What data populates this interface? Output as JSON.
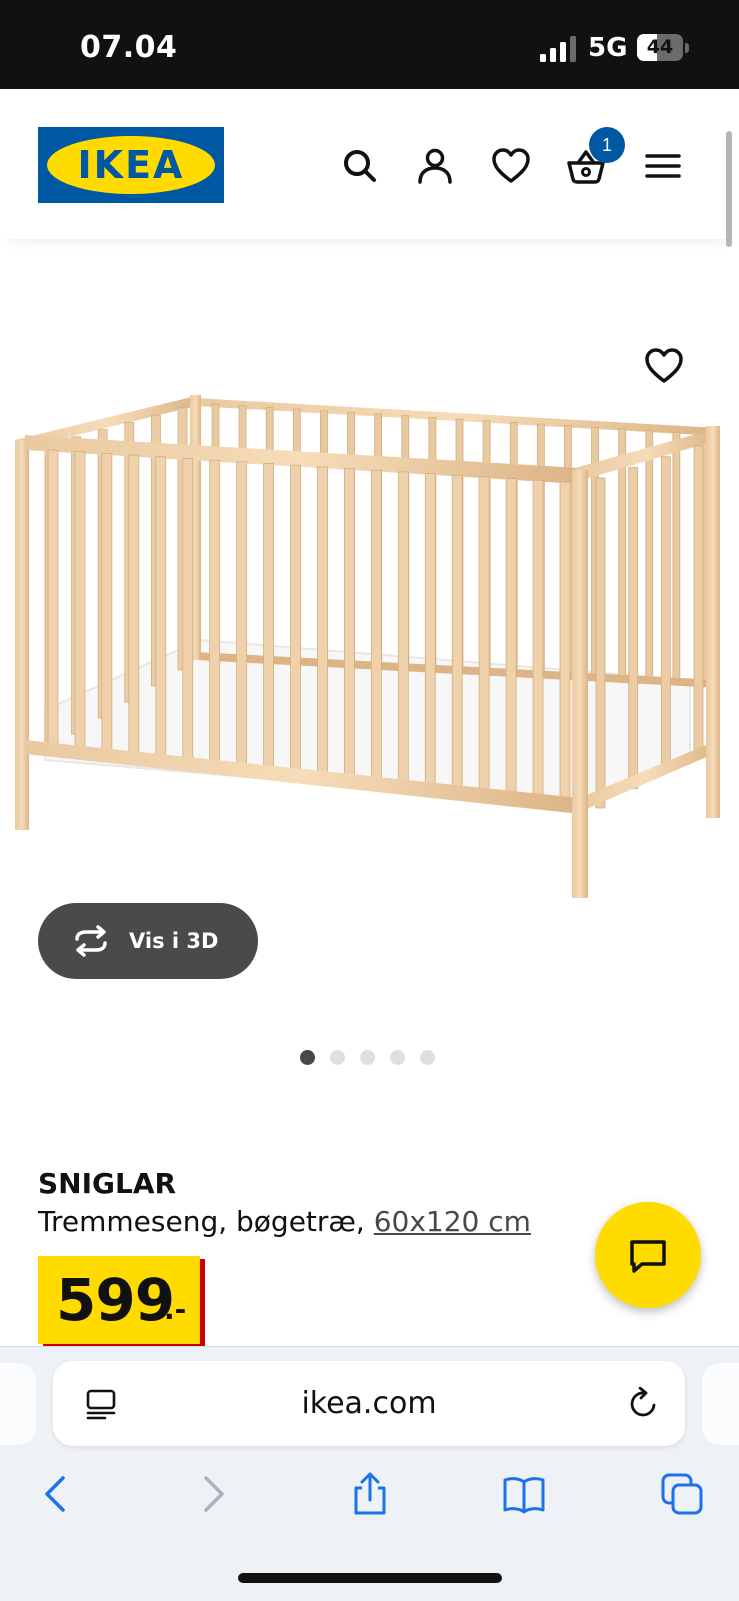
{
  "status_bar": {
    "time": "07.04",
    "network": "5G",
    "battery_percent": 44,
    "battery_label": "44"
  },
  "header": {
    "logo_text": "IKEA",
    "icons": [
      "search-icon",
      "user-icon",
      "heart-icon",
      "basket-icon",
      "menu-icon"
    ],
    "cart_count": "1",
    "colors": {
      "brand_blue": "#0058a3",
      "brand_yellow": "#ffdb00"
    }
  },
  "gallery": {
    "view_3d_label": "Vis i 3D",
    "image_count": 5,
    "active_index": 0
  },
  "product": {
    "name": "SNIGLAR",
    "description": "Tremmeseng, bøgetræ,",
    "size": "60x120 cm",
    "price": "599",
    "price_suffix": ".-",
    "price_accent": "#cc0008"
  },
  "browser": {
    "url": "ikea.com",
    "icons": [
      "reader-icon",
      "reload-icon",
      "back-icon",
      "forward-icon",
      "share-icon",
      "bookmarks-icon",
      "tabs-icon"
    ]
  }
}
